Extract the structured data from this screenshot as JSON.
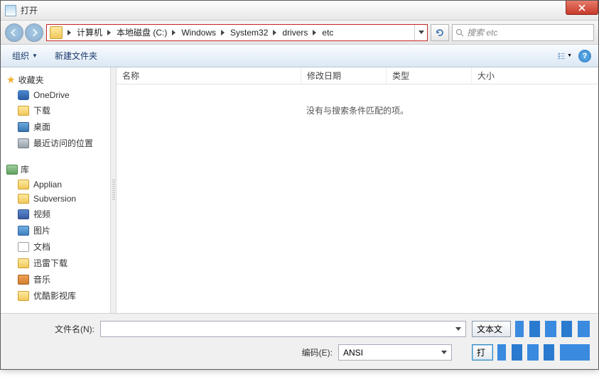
{
  "title": "打开",
  "breadcrumbs": [
    "计算机",
    "本地磁盘 (C:)",
    "Windows",
    "System32",
    "drivers",
    "etc"
  ],
  "search_placeholder": "搜索 etc",
  "toolbar": {
    "organize": "组织",
    "new_folder": "新建文件夹"
  },
  "columns": {
    "name": "名称",
    "modified": "修改日期",
    "type": "类型",
    "size": "大小"
  },
  "empty_msg": "没有与搜索条件匹配的项。",
  "sidebar": {
    "favorites": {
      "label": "收藏夹",
      "items": [
        "OneDrive",
        "下载",
        "桌面",
        "最近访问的位置"
      ]
    },
    "libraries": {
      "label": "库",
      "items": [
        "Applian",
        "Subversion",
        "视频",
        "图片",
        "文档",
        "迅雷下载",
        "音乐",
        "优酷影视库"
      ]
    }
  },
  "bottom": {
    "filename_label": "文件名(N):",
    "filename_value": "",
    "filter_label": "文本文",
    "encoding_label": "编码(E):",
    "encoding_value": "ANSI",
    "open_label": "打"
  }
}
